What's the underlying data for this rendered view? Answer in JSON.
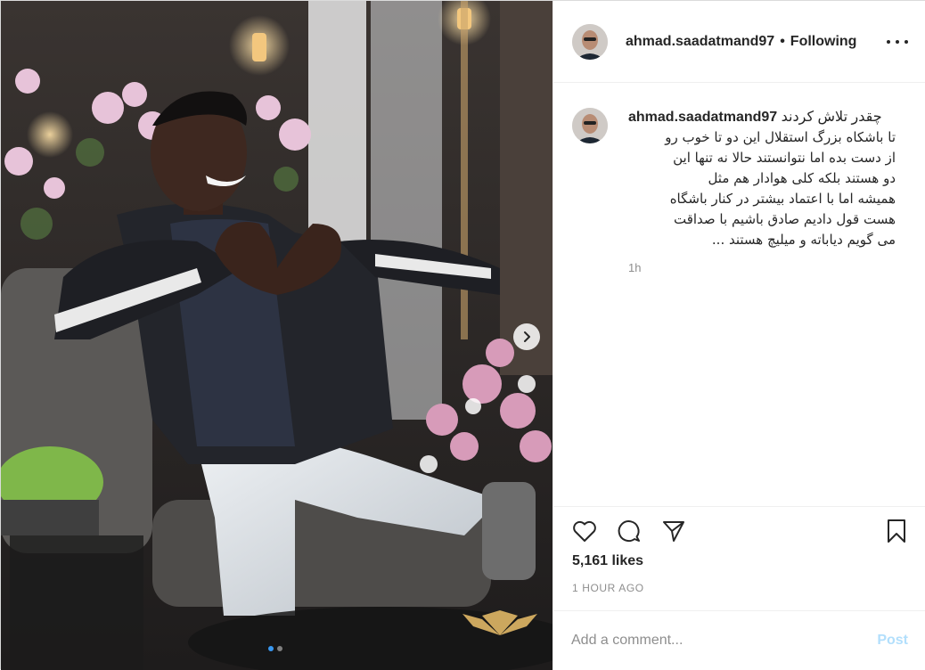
{
  "header": {
    "username": "ahmad.saadatmand97",
    "separator": "•",
    "follow_status": "Following"
  },
  "caption": {
    "username": "ahmad.saadatmand97",
    "lines": [
      "چقدر تلاش کردند",
      "تا باشکاه بزرگ استقلال این دو تا خوب رو",
      "از دست بده اما نتوانستند حالا نه تنها این",
      "دو هستند بلکه کلی هوادار هم مثل",
      "همیشه اما با اعتماد بیشتر در کنار باشگاه",
      "هست قول دادیم صادق باشیم با صداقت",
      "می گویم دیاباته و میلیچ هستند ..."
    ],
    "time_ago": "1h"
  },
  "engagement": {
    "likes": "5,161 likes",
    "timestamp": "1 HOUR AGO"
  },
  "comment": {
    "placeholder": "Add a comment...",
    "post_label": "Post"
  },
  "carousel": {
    "slide_count": 2,
    "active_index": 0
  },
  "colors": {
    "link_blue": "#3897f0",
    "post_disabled": "#b2dffc",
    "muted_text": "#8e8e8e",
    "border": "#efefef"
  },
  "icons": [
    "more-options-icon",
    "heart-icon",
    "comment-icon",
    "share-icon",
    "bookmark-icon",
    "chevron-right-icon"
  ]
}
